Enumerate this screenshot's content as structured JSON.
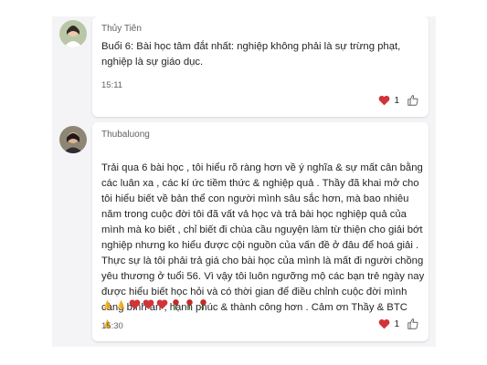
{
  "messages": [
    {
      "author": "Thủy Tiên",
      "text": "Buổi 6: Bài học tâm đắt nhất: nghiệp không phải là sự trừng phạt,\nnghiệp là sự giáo dục.",
      "time": "15:11",
      "reaction_count": "1"
    },
    {
      "author": "Thubaluong",
      "text": "Trải qua 6 bài học , tôi hiểu rõ ràng hơn về ý nghĩa & sự mất cân bằng\ncác luân xa , các kí ức tiềm thức & nghiệp quả . Thầy đã khai mở cho\ntôi hiểu biết về bản thể con người mình sâu sắc hơn, mà bao nhiêu\nnăm trong cuộc đời tôi đã vất vả  học và trả bài học nghiệp quả của\nmình mà ko biết , chỉ biết đi chùa cầu nguyện làm từ thiện cho giải bớt\nnghiệp nhưng ko hiểu được cội nguồn của vấn đề ở đâu để hoá giải .\nThực sự là tôi phải trả giá cho bài học của mình là mất đi người chồng\nyêu thương ở tuổi 56. Vì vậy tôi luôn ngưỡng mộ các bạn trẻ ngày nay\nđược hiểu biết học hỏi và có thời gian để điều chỉnh cuộc đời mình\ncàng bình an , hạnh phúc & thành công hơn . Cảm ơn Thầy & BTC",
      "time": "15:30",
      "reaction_count": "1",
      "emoji_line": [
        "praying-hands",
        "praying-hands",
        "heart",
        "heart",
        "heart",
        "rose",
        "rose",
        "rose"
      ]
    }
  ],
  "colors": {
    "thread_bg": "#f4f4f6",
    "heart": "#d13438",
    "text": "#242424",
    "muted": "#616161"
  }
}
